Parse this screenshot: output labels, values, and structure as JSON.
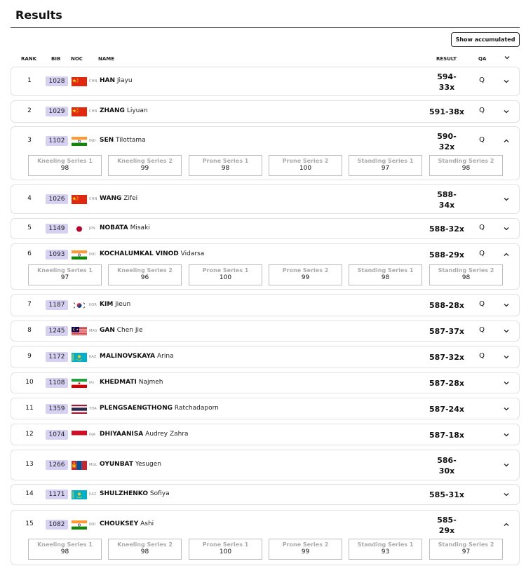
{
  "page": {
    "title": "Results",
    "show_accumulated_label": "Show accumulated"
  },
  "columns": {
    "rank": "RANK",
    "bib": "BIB",
    "noc": "NOC",
    "name": "NAME",
    "result": "RESULT",
    "qa": "QA"
  },
  "series_labels": [
    "Kneeling Series 1",
    "Kneeling Series 2",
    "Prone Series 1",
    "Prone Series 2",
    "Standing Series 1",
    "Standing Series 2"
  ],
  "rows": [
    {
      "rank": "1",
      "bib": "1028",
      "noc": "CHN",
      "surname": "HAN",
      "given": "Jiayu",
      "result_l1": "594-",
      "result_l2": "33x",
      "qa": "Q",
      "expanded": false,
      "flag": "chn-flag-icon"
    },
    {
      "rank": "2",
      "bib": "1029",
      "noc": "CHN",
      "surname": "ZHANG",
      "given": "Liyuan",
      "result_l1": "591-38x",
      "result_l2": "",
      "qa": "Q",
      "expanded": false,
      "flag": "chn-flag-icon"
    },
    {
      "rank": "3",
      "bib": "1102",
      "noc": "IND",
      "surname": "SEN",
      "given": "Tilottama",
      "result_l1": "590-",
      "result_l2": "32x",
      "qa": "Q",
      "expanded": true,
      "scores": [
        "98",
        "99",
        "98",
        "100",
        "97",
        "98"
      ],
      "flag": "ind-flag-icon"
    },
    {
      "rank": "4",
      "bib": "1026",
      "noc": "CHN",
      "surname": "WANG",
      "given": "Zifei",
      "result_l1": "588-",
      "result_l2": "34x",
      "qa": "",
      "expanded": false,
      "flag": "chn-flag-icon"
    },
    {
      "rank": "5",
      "bib": "1149",
      "noc": "JPN",
      "surname": "NOBATA",
      "given": "Misaki",
      "result_l1": "588-32x",
      "result_l2": "",
      "qa": "Q",
      "expanded": false,
      "flag": "jpn-flag-icon"
    },
    {
      "rank": "6",
      "bib": "1093",
      "noc": "IND",
      "surname": "KOCHALUMKAL VINOD",
      "given": "Vidarsa",
      "result_l1": "588-29x",
      "result_l2": "",
      "qa": "Q",
      "expanded": true,
      "scores": [
        "97",
        "96",
        "100",
        "99",
        "98",
        "98"
      ],
      "flag": "ind-flag-icon"
    },
    {
      "rank": "7",
      "bib": "1187",
      "noc": "KOR",
      "surname": "KIM",
      "given": "Jieun",
      "result_l1": "588-28x",
      "result_l2": "",
      "qa": "Q",
      "expanded": false,
      "flag": "kor-flag-icon"
    },
    {
      "rank": "8",
      "bib": "1245",
      "noc": "MAS",
      "surname": "GAN",
      "given": "Chen Jie",
      "result_l1": "587-37x",
      "result_l2": "",
      "qa": "Q",
      "expanded": false,
      "flag": "mas-flag-icon"
    },
    {
      "rank": "9",
      "bib": "1172",
      "noc": "KAZ",
      "surname": "MALINOVSKAYA",
      "given": "Arina",
      "result_l1": "587-32x",
      "result_l2": "",
      "qa": "Q",
      "expanded": false,
      "flag": "kaz-flag-icon"
    },
    {
      "rank": "10",
      "bib": "1108",
      "noc": "IRI",
      "surname": "KHEDMATI",
      "given": "Najmeh",
      "result_l1": "587-28x",
      "result_l2": "",
      "qa": "",
      "expanded": false,
      "flag": "iri-flag-icon"
    },
    {
      "rank": "11",
      "bib": "1359",
      "noc": "THA",
      "surname": "PLENGSAENGTHONG",
      "given": "Ratchadaporn",
      "result_l1": "587-24x",
      "result_l2": "",
      "qa": "",
      "expanded": false,
      "flag": "tha-flag-icon"
    },
    {
      "rank": "12",
      "bib": "1074",
      "noc": "INA",
      "surname": "DHIYAANISA",
      "given": "Audrey Zahra",
      "result_l1": "587-18x",
      "result_l2": "",
      "qa": "",
      "expanded": false,
      "flag": "ina-flag-icon"
    },
    {
      "rank": "13",
      "bib": "1266",
      "noc": "MGL",
      "surname": "OYUNBAT",
      "given": "Yesugen",
      "result_l1": "586-",
      "result_l2": "30x",
      "qa": "",
      "expanded": false,
      "flag": "mgl-flag-icon"
    },
    {
      "rank": "14",
      "bib": "1171",
      "noc": "KAZ",
      "surname": "SHULZHENKO",
      "given": "Sofiya",
      "result_l1": "585-31x",
      "result_l2": "",
      "qa": "",
      "expanded": false,
      "flag": "kaz-flag-icon"
    },
    {
      "rank": "15",
      "bib": "1082",
      "noc": "IND",
      "surname": "CHOUKSEY",
      "given": "Ashi",
      "result_l1": "585-",
      "result_l2": "29x",
      "qa": "",
      "expanded": true,
      "scores": [
        "98",
        "98",
        "100",
        "99",
        "93",
        "97"
      ],
      "flag": "ind-flag-icon"
    }
  ]
}
